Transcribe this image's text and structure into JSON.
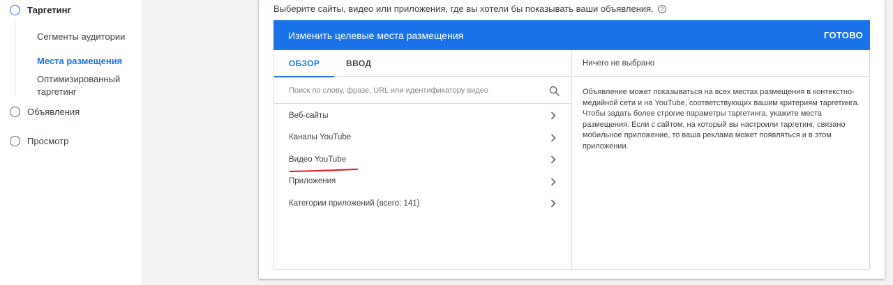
{
  "sidebar": {
    "steps": [
      {
        "label": "Таргетинг",
        "active": true
      },
      {
        "label": "Объявления",
        "active": false
      },
      {
        "label": "Просмотр",
        "active": false
      }
    ],
    "substeps": [
      {
        "label": "Сегменты аудитории"
      },
      {
        "label": "Места размещения",
        "current": true
      },
      {
        "label": "Оптимизированный таргетинг"
      }
    ]
  },
  "main": {
    "intro": "Выберите сайты, видео или приложения, где вы хотели бы показывать ваши объявления.",
    "help_icon": "?",
    "editor": {
      "title": "Изменить целевые места размещения",
      "done_label": "ГОТОВО",
      "tabs": [
        {
          "label": "ОБЗОР",
          "selected": true
        },
        {
          "label": "ВВОД",
          "selected": false
        }
      ],
      "search_placeholder": "Поиск по слову, фразе, URL или идентификатору видео",
      "categories": [
        {
          "label": "Веб-сайты"
        },
        {
          "label": "Каналы YouTube",
          "highlighted": true
        },
        {
          "label": "Видео YouTube"
        },
        {
          "label": "Приложения"
        },
        {
          "label": "Категории приложений (всего: 141)"
        }
      ],
      "selected_header": "Ничего не выбрано",
      "description": "Объявление может показываться на всех местах размещения в контекстно-медийной сети и на YouTube, соответствующих вашим критериям таргетинга. Чтобы задать более строгие параметры таргетинга, укажите места размещения. Если с сайтом, на который вы настроили таргетинг, связано мобильное приложение, то ваша реклама может появляться и в этом приложении."
    }
  },
  "colors": {
    "accent": "#1a73e8",
    "background": "#f1f3f4",
    "annotation": "#e8121c"
  },
  "icons": [
    "step-circle-icon",
    "help-icon",
    "search-icon",
    "chevron-right-icon"
  ]
}
